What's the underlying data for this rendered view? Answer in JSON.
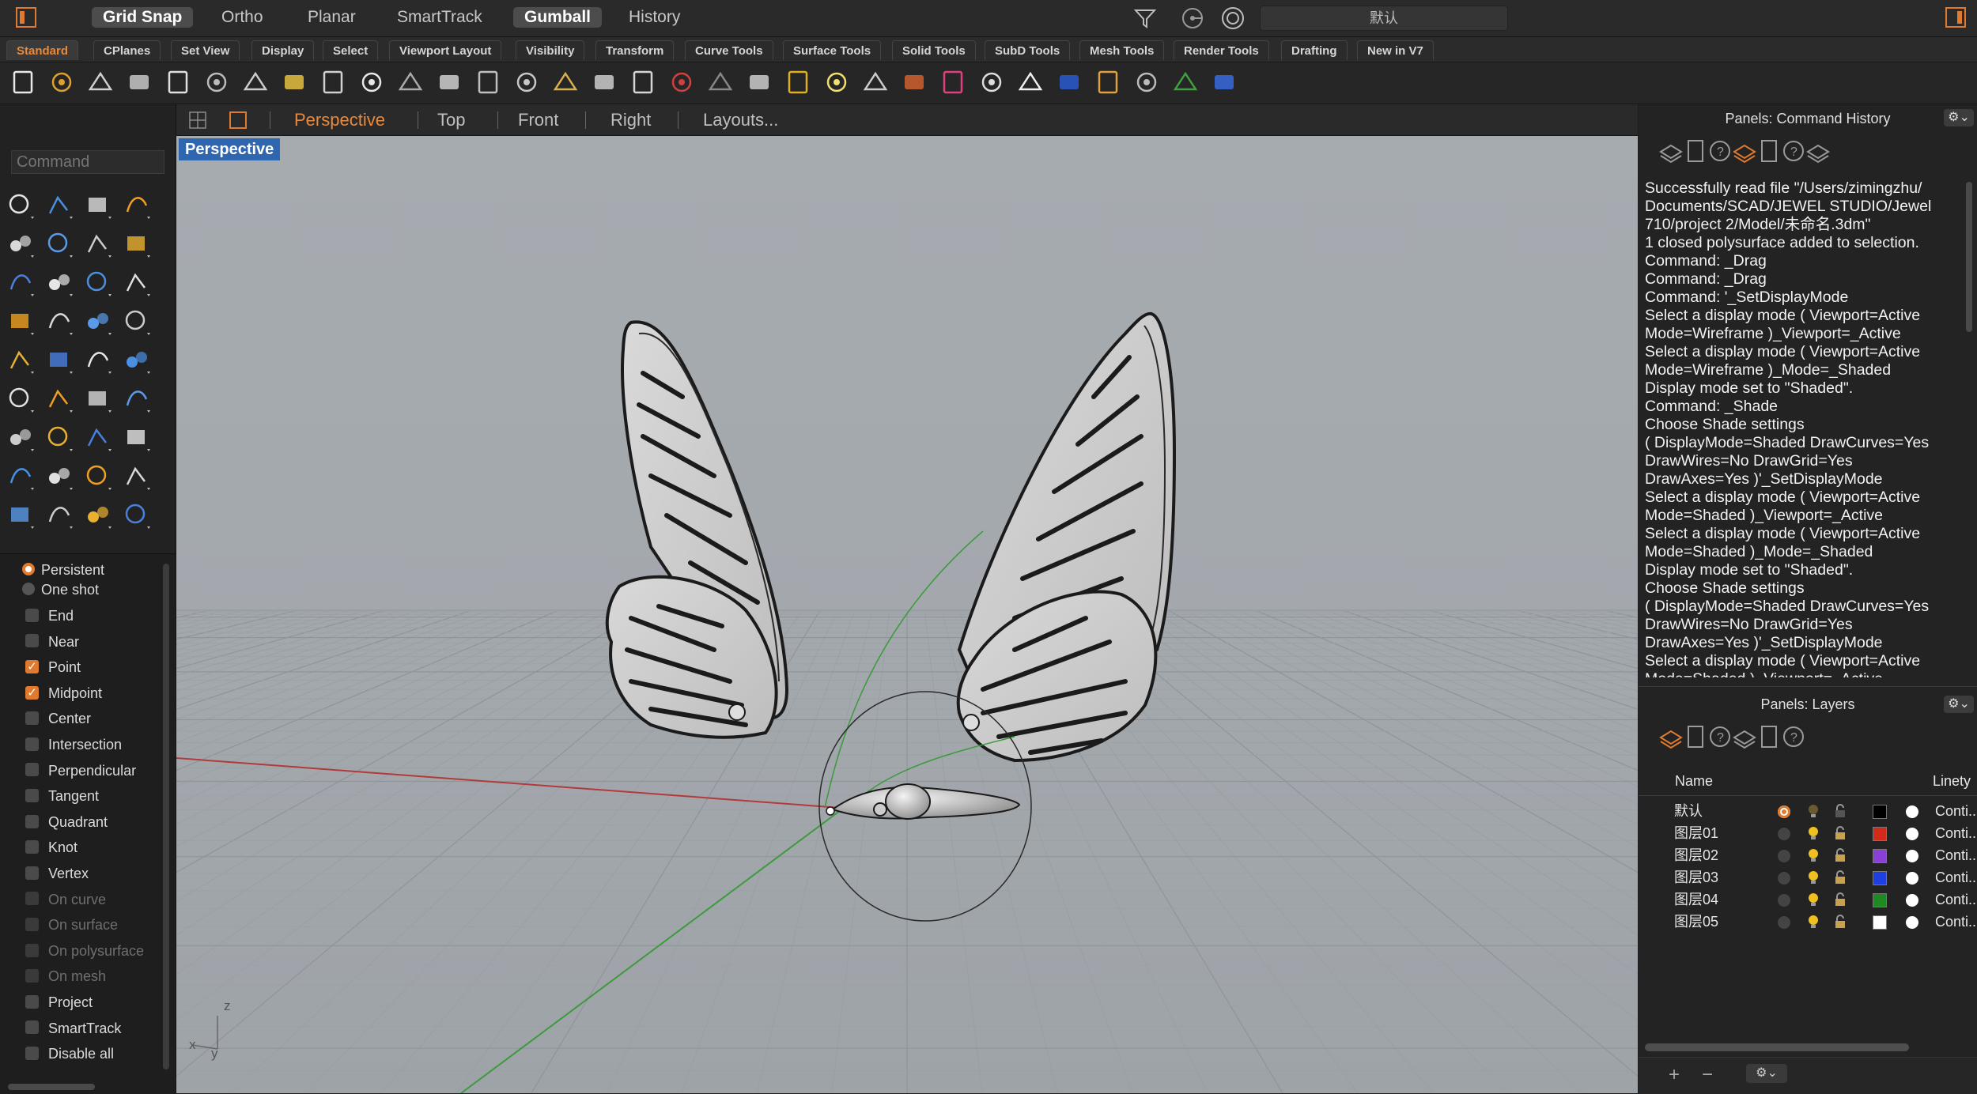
{
  "topbar": {
    "toggles": [
      {
        "label": "Grid Snap",
        "on": true
      },
      {
        "label": "Ortho",
        "on": false
      },
      {
        "label": "Planar",
        "on": false
      },
      {
        "label": "SmartTrack",
        "on": false
      },
      {
        "label": "Gumball",
        "on": true
      },
      {
        "label": "History",
        "on": false
      }
    ],
    "current_layer": "默认",
    "mode_icons": [
      "filter-icon",
      "snap-target-icon",
      "record-icon"
    ]
  },
  "tabs": [
    "Standard",
    "CPlanes",
    "Set View",
    "Display",
    "Select",
    "Viewport Layout",
    "Visibility",
    "Transform",
    "Curve Tools",
    "Surface Tools",
    "Solid Tools",
    "SubD Tools",
    "Mesh Tools",
    "Render Tools",
    "Drafting",
    "New in V7"
  ],
  "active_tab": "Standard",
  "toolbar_icons": [
    "new-file-icon",
    "open-icon",
    "save-icon",
    "print-icon",
    "import-icon",
    "cut-icon",
    "copy-icon",
    "paste-icon",
    "undo-icon",
    "pan-hand-icon",
    "rotate-view-icon",
    "zoom-icon",
    "zoom-window-icon",
    "zoom-extents-icon",
    "zoom-selected-icon",
    "rotate-camera-icon",
    "four-viewports-icon",
    "car-icon",
    "cplane-icon",
    "snapshot-icon",
    "points-icon",
    "light-icon",
    "lock-icon",
    "hide-icon",
    "color-wheel-icon",
    "wireframe-sphere-icon",
    "shaded-sphere-icon",
    "render-sphere-icon",
    "material-icon",
    "grid-options-icon",
    "history-record-icon",
    "help-icon"
  ],
  "command": {
    "placeholder": "Command"
  },
  "tool_icons": [
    "select-icon",
    "point-icon",
    "polyline-icon",
    "curve-icon",
    "circle-icon",
    "ellipse-icon",
    "polygon-icon",
    "rectangle-icon",
    "arc-icon",
    "fillet-icon",
    "extrude-icon",
    "surface-icon",
    "box-icon",
    "sphere-icon",
    "cylinder-icon",
    "plane-icon",
    "boolean-icon",
    "explode-icon",
    "split-icon",
    "trim-icon",
    "group-icon",
    "join-icon",
    "offset-icon",
    "blend-icon",
    "text-icon",
    "scale-icon",
    "array-icon",
    "dimension-icon",
    "block-icon",
    "move-icon",
    "grid-array-icon",
    "distance-icon",
    "hatch-icon",
    "check-icon",
    "analyze-icon",
    "paint-icon"
  ],
  "osnap": {
    "modes": [
      {
        "label": "Persistent",
        "selected": true
      },
      {
        "label": "One shot",
        "selected": false
      }
    ],
    "snaps": [
      {
        "label": "End",
        "checked": false,
        "enabled": true
      },
      {
        "label": "Near",
        "checked": false,
        "enabled": true
      },
      {
        "label": "Point",
        "checked": true,
        "enabled": true
      },
      {
        "label": "Midpoint",
        "checked": true,
        "enabled": true
      },
      {
        "label": "Center",
        "checked": false,
        "enabled": true
      },
      {
        "label": "Intersection",
        "checked": false,
        "enabled": true
      },
      {
        "label": "Perpendicular",
        "checked": false,
        "enabled": true
      },
      {
        "label": "Tangent",
        "checked": false,
        "enabled": true
      },
      {
        "label": "Quadrant",
        "checked": false,
        "enabled": true
      },
      {
        "label": "Knot",
        "checked": false,
        "enabled": true
      },
      {
        "label": "Vertex",
        "checked": false,
        "enabled": true
      },
      {
        "label": "On curve",
        "checked": false,
        "enabled": false
      },
      {
        "label": "On surface",
        "checked": false,
        "enabled": false
      },
      {
        "label": "On polysurface",
        "checked": false,
        "enabled": false
      },
      {
        "label": "On mesh",
        "checked": false,
        "enabled": false
      },
      {
        "label": "Project",
        "checked": false,
        "enabled": true
      },
      {
        "label": "SmartTrack",
        "checked": false,
        "enabled": true
      },
      {
        "label": "Disable all",
        "checked": false,
        "enabled": true
      }
    ]
  },
  "viewport": {
    "tabs": [
      "Perspective",
      "Top",
      "Front",
      "Right",
      "Layouts..."
    ],
    "active": "Perspective",
    "label": "Perspective",
    "axis_x": "x",
    "axis_y": "y",
    "axis_z": "z"
  },
  "command_history": {
    "title": "Panels: Command History",
    "panel_icons": [
      "layers-icon",
      "document-icon",
      "object-icon",
      "display-icon",
      "monitor-icon",
      "help-icon",
      "grid-icon"
    ],
    "lines": [
      "Successfully read file \"/Users/zimingzhu/",
      "Documents/SCAD/JEWEL STUDIO/Jewel",
      "710/project 2/Model/未命名.3dm\"",
      "1 closed polysurface added to selection.",
      "Command: _Drag",
      "Command: _Drag",
      "Command: '_SetDisplayMode",
      "Select a display mode ( Viewport=Active",
      "Mode=Wireframe )_Viewport=_Active",
      "Select a display mode ( Viewport=Active",
      "Mode=Wireframe )_Mode=_Shaded",
      "Display mode set to \"Shaded\".",
      "Command: _Shade",
      "Choose Shade settings",
      "( DisplayMode=Shaded DrawCurves=Yes",
      "DrawWires=No DrawGrid=Yes",
      "DrawAxes=Yes )'_SetDisplayMode",
      "Select a display mode ( Viewport=Active",
      "Mode=Shaded )_Viewport=_Active",
      "Select a display mode ( Viewport=Active",
      "Mode=Shaded )_Mode=_Shaded",
      "Display mode set to \"Shaded\".",
      "Choose Shade settings",
      "( DisplayMode=Shaded DrawCurves=Yes",
      "DrawWires=No DrawGrid=Yes",
      "DrawAxes=Yes )'_SetDisplayMode",
      "Select a display mode ( Viewport=Active",
      "Mode=Shaded )_Viewport=_Active"
    ]
  },
  "layers": {
    "title": "Panels: Layers",
    "panel_icons": [
      "layers-icon",
      "object-icon",
      "document-icon",
      "display-icon",
      "monitor-icon",
      "help-icon"
    ],
    "col_name": "Name",
    "col_linetype": "Linety",
    "rows": [
      {
        "name": "默认",
        "current": true,
        "color": "#000000",
        "linetype": "Conti..."
      },
      {
        "name": "图层01",
        "current": false,
        "color": "#d42a1a",
        "linetype": "Conti..."
      },
      {
        "name": "图层02",
        "current": false,
        "color": "#8a3fd6",
        "linetype": "Conti..."
      },
      {
        "name": "图层03",
        "current": false,
        "color": "#1f3fe0",
        "linetype": "Conti..."
      },
      {
        "name": "图层04",
        "current": false,
        "color": "#1e8a22",
        "linetype": "Conti..."
      },
      {
        "name": "图层05",
        "current": false,
        "color": "#ffffff",
        "linetype": "Conti..."
      }
    ],
    "footer_add": "+",
    "footer_remove": "−"
  },
  "colors": {
    "accent": "#e07a2e",
    "viewport_bg": "#a3a8ad",
    "label_bg": "#2f66b0"
  }
}
